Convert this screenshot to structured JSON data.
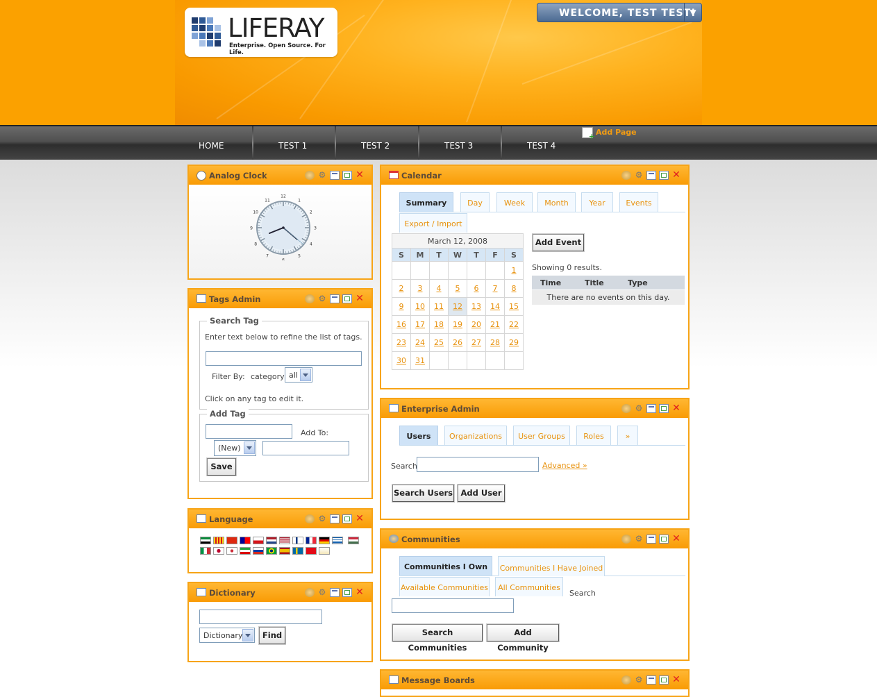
{
  "header": {
    "logo_word": "LIFERAY",
    "logo_tagline": "Enterprise. Open Source. For Life.",
    "welcome": "WELCOME, TEST TEST!"
  },
  "nav": {
    "items": [
      "HOME",
      "TEST 1",
      "TEST 2",
      "TEST 3",
      "TEST 4"
    ],
    "add_page": "Add Page"
  },
  "clock": {
    "title": "Analog Clock",
    "numbers": [
      "12",
      "1",
      "2",
      "3",
      "4",
      "5",
      "6",
      "7",
      "8",
      "9",
      "10",
      "11"
    ]
  },
  "tags": {
    "title": "Tags Admin",
    "search_legend": "Search Tag",
    "search_help": "Enter text below to refine the list of tags.",
    "filter_label": "Filter By:",
    "filter_category": "category",
    "filter_value": "all",
    "click_help": "Click on any tag to edit it.",
    "add_legend": "Add Tag",
    "add_to_label": "Add To:",
    "new_value": "(New)",
    "save": "Save"
  },
  "language": {
    "title": "Language"
  },
  "dictionary": {
    "title": "Dictionary",
    "select_value": "Dictionary",
    "find": "Find"
  },
  "calendar": {
    "title": "Calendar",
    "tabs": [
      "Summary",
      "Day",
      "Week",
      "Month",
      "Year",
      "Events"
    ],
    "export_tab": "Export / Import",
    "month_label": "March 12, 2008",
    "weekdays": [
      "S",
      "M",
      "T",
      "W",
      "T",
      "F",
      "S"
    ],
    "weeks": [
      [
        "",
        "",
        "",
        "",
        "",
        "",
        "1"
      ],
      [
        "2",
        "3",
        "4",
        "5",
        "6",
        "7",
        "8"
      ],
      [
        "9",
        "10",
        "11",
        "12",
        "13",
        "14",
        "15"
      ],
      [
        "16",
        "17",
        "18",
        "19",
        "20",
        "21",
        "22"
      ],
      [
        "23",
        "24",
        "25",
        "26",
        "27",
        "28",
        "29"
      ],
      [
        "30",
        "31",
        "",
        "",
        "",
        "",
        ""
      ]
    ],
    "add_event": "Add Event",
    "showing": "Showing 0 results.",
    "cols": [
      "Time",
      "Title",
      "Type"
    ],
    "empty": "There are no events on this day."
  },
  "enterprise": {
    "title": "Enterprise Admin",
    "tabs": [
      "Users",
      "Organizations",
      "User Groups",
      "Roles",
      "»"
    ],
    "search_label": "Search",
    "advanced": "Advanced »",
    "search_btn": "Search Users",
    "add_btn": "Add User"
  },
  "communities": {
    "title": "Communities",
    "tabs": [
      "Communities I Own",
      "Communities I Have Joined",
      "Available Communities",
      "All Communities"
    ],
    "search_label": "Search",
    "search_btn": "Search Communities",
    "add_btn": "Add Community"
  },
  "boards": {
    "title": "Message Boards"
  },
  "colors": {
    "accent": "#f7a416",
    "link": "#e8920e",
    "tab_selected": "#cfe3f7"
  }
}
